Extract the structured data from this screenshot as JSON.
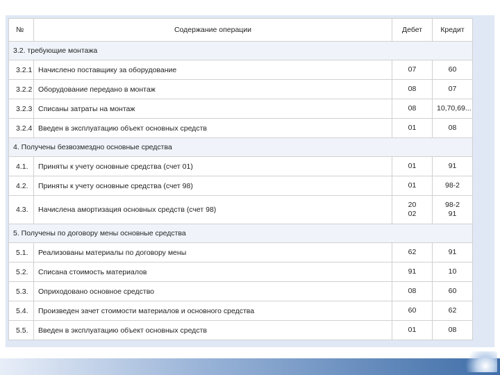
{
  "table": {
    "header": {
      "num": "№",
      "desc": "Содержание операции",
      "debit": "Дебет",
      "credit": "Кредит"
    },
    "sections": [
      {
        "title": "3.2. требующие монтажа",
        "rows": [
          {
            "num": "3.2.1",
            "desc": "Начислено поставщику за оборудование",
            "debit": [
              "07"
            ],
            "credit": [
              "60"
            ]
          },
          {
            "num": "3.2.2",
            "desc": "Оборудование передано в монтаж",
            "debit": [
              "08"
            ],
            "credit": [
              "07"
            ]
          },
          {
            "num": "3.2.3",
            "desc": "Списаны затраты на монтаж",
            "debit": [
              "08"
            ],
            "credit": [
              "10,70,69..."
            ]
          },
          {
            "num": "3.2.4",
            "desc": "Введен в эксплуатацию объект основных средств",
            "debit": [
              "01"
            ],
            "credit": [
              "08"
            ]
          }
        ]
      },
      {
        "title": "4. Получены безвозмездно основные средства",
        "rows": [
          {
            "num": "4.1.",
            "desc": "Приняты к учету основные средства (счет 01)",
            "debit": [
              "01"
            ],
            "credit": [
              "91"
            ]
          },
          {
            "num": "4.2.",
            "desc": "Приняты к учету основные средства (счет 98)",
            "debit": [
              "01"
            ],
            "credit": [
              "98-2"
            ]
          },
          {
            "num": "4.3.",
            "desc": "Начислена амортизация основных средств (счет 98)",
            "debit": [
              "20",
              "02"
            ],
            "credit": [
              "98-2",
              "91"
            ]
          }
        ]
      },
      {
        "title": "5. Получены по договору мены основные средства",
        "rows": [
          {
            "num": "5.1.",
            "desc": "Реализованы материалы по договору мены",
            "debit": [
              "62"
            ],
            "credit": [
              "91"
            ]
          },
          {
            "num": "5.2.",
            "desc": "Списана стоимость материалов",
            "debit": [
              "91"
            ],
            "credit": [
              "10"
            ]
          },
          {
            "num": "5.3.",
            "desc": "Оприходовано основное средство",
            "debit": [
              "08"
            ],
            "credit": [
              "60"
            ]
          },
          {
            "num": "5.4.",
            "desc": "Произведен зачет стоимости материалов и основного средства",
            "debit": [
              "60"
            ],
            "credit": [
              "62"
            ]
          },
          {
            "num": "5.5.",
            "desc": "Введен в эксплуатацию объект основных средств",
            "debit": [
              "01"
            ],
            "credit": [
              "08"
            ]
          }
        ]
      }
    ]
  }
}
